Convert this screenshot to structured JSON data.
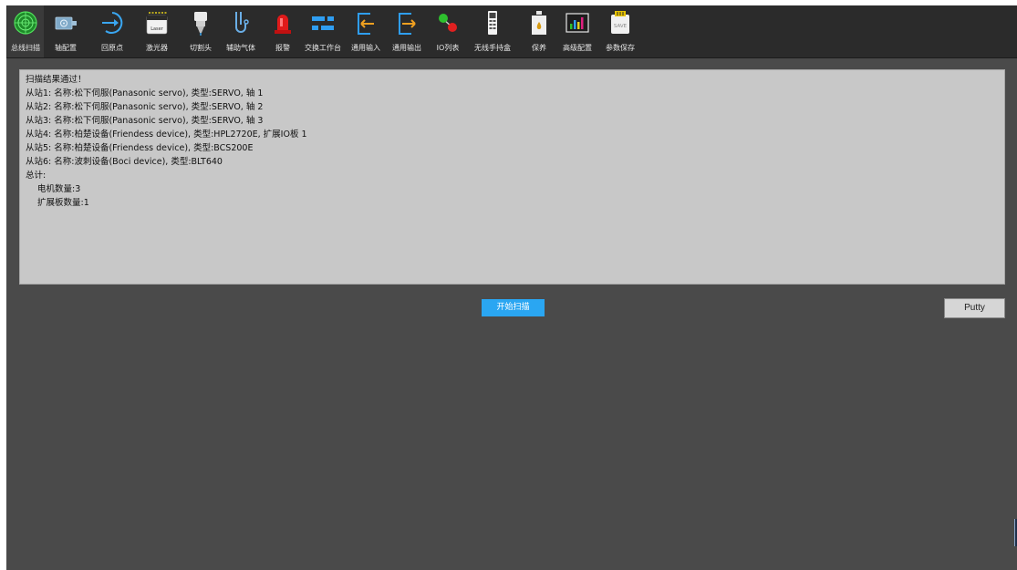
{
  "toolbar": {
    "items": [
      {
        "label": "总线扫描",
        "icon": "radar-icon",
        "active": true
      },
      {
        "label": "轴配置",
        "icon": "servo-motor-icon"
      },
      {
        "label": "回原点",
        "icon": "return-home-icon"
      },
      {
        "label": "激光器",
        "icon": "laser-icon",
        "icon_text": "Laser"
      },
      {
        "label": "切割头",
        "icon": "cutting-head-icon"
      },
      {
        "label": "辅助气体",
        "icon": "gas-icon"
      },
      {
        "label": "报警",
        "icon": "alarm-light-icon"
      },
      {
        "label": "交换工作台",
        "icon": "exchange-table-icon"
      },
      {
        "label": "通用输入",
        "icon": "input-icon"
      },
      {
        "label": "通用输出",
        "icon": "output-icon"
      },
      {
        "label": "IO列表",
        "icon": "io-list-icon"
      },
      {
        "label": "无线手持盒",
        "icon": "wireless-remote-icon"
      },
      {
        "label": "保养",
        "icon": "oil-can-icon"
      },
      {
        "label": "高级配置",
        "icon": "advanced-config-icon"
      },
      {
        "label": "参数保存",
        "icon": "save-card-icon",
        "icon_text": "SAVE"
      }
    ]
  },
  "result": {
    "lines": [
      "扫描结果通过！",
      "从站1: 名称:松下伺服(Panasonic servo), 类型:SERVO, 轴 1",
      "从站2: 名称:松下伺服(Panasonic servo), 类型:SERVO, 轴 2",
      "从站3: 名称:松下伺服(Panasonic servo), 类型:SERVO, 轴 3",
      "从站4: 名称:柏楚设备(Friendess device), 类型:HPL2720E, 扩展IO板 1",
      "从站5: 名称:柏楚设备(Friendess device), 类型:BCS200E",
      "从站6: 名称:波刺设备(Boci device), 类型:BLT640",
      "总计:",
      "电机数量:3",
      "扩展板数量:1"
    ]
  },
  "buttons": {
    "scan": "开始扫描",
    "putty": "Putty"
  },
  "colors": {
    "toolbar_bg": "#2b2b2b",
    "window_bg": "#4a4a4a",
    "result_bg": "#c8c8c8",
    "accent": "#2aa6f2"
  }
}
